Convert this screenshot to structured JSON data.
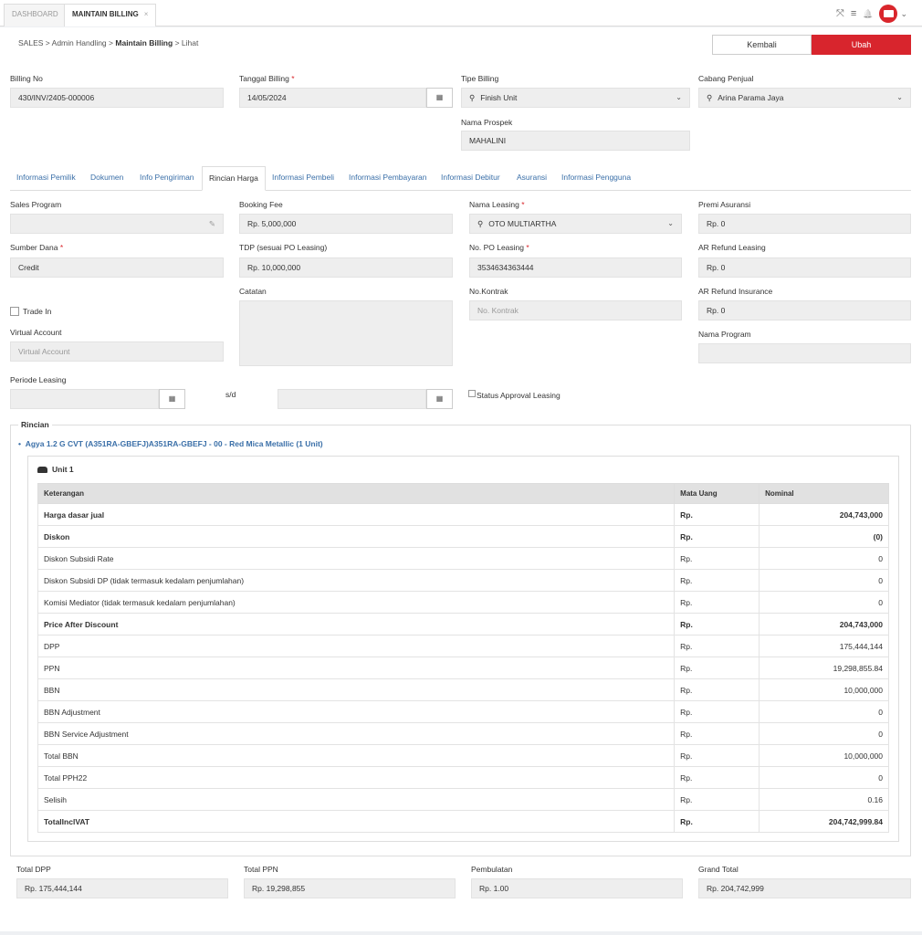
{
  "tabs": [
    {
      "label": "DASHBOARD"
    },
    {
      "label": "MAINTAIN BILLING",
      "close": "×"
    }
  ],
  "breadcrumb": {
    "l1": "SALES",
    "l2": "Admin Handling",
    "l3": "Maintain Billing",
    "l4": "Lihat",
    "sep": ">"
  },
  "buttons": {
    "kembali": "Kembali",
    "ubah": "Ubah"
  },
  "header": {
    "billing_no": {
      "label": "Billing No",
      "value": "430/INV/2405-000006"
    },
    "tanggal_billing": {
      "label": "Tanggal Billing",
      "value": "14/05/2024"
    },
    "tipe_billing": {
      "label": "Tipe Billing",
      "value": "Finish Unit"
    },
    "cabang_penjual": {
      "label": "Cabang Penjual",
      "value": "Arina Parama Jaya"
    },
    "nama_prospek": {
      "label": "Nama Prospek",
      "value": "MAHALINI"
    }
  },
  "sections": [
    {
      "label": "Informasi Pemilik"
    },
    {
      "label": "Dokumen"
    },
    {
      "label": "Info Pengiriman"
    },
    {
      "label": "Rincian Harga"
    },
    {
      "label": "Informasi Pembeli"
    },
    {
      "label": "Informasi Pembayaran"
    },
    {
      "label": "Informasi Debitur"
    },
    {
      "label": "Asuransi"
    },
    {
      "label": "Informasi Pengguna"
    }
  ],
  "rincian_harga": {
    "sales_program": {
      "label": "Sales Program",
      "value": ""
    },
    "booking_fee": {
      "label": "Booking Fee",
      "value": "Rp. 5,000,000"
    },
    "nama_leasing": {
      "label": "Nama Leasing",
      "value": "OTO MULTIARTHA"
    },
    "premi_asuransi": {
      "label": "Premi Asuransi",
      "value": "Rp. 0"
    },
    "sumber_dana": {
      "label": "Sumber Dana",
      "value": "Credit"
    },
    "tdp": {
      "label": "TDP (sesuai PO Leasing)",
      "value": "Rp. 10,000,000"
    },
    "no_po_leasing": {
      "label": "No. PO Leasing",
      "value": "3534634363444"
    },
    "ar_refund_leasing": {
      "label": "AR Refund Leasing",
      "value": "Rp. 0"
    },
    "catatan": {
      "label": "Catatan",
      "value": ""
    },
    "no_kontrak": {
      "label": "No.Kontrak",
      "placeholder": "No. Kontrak"
    },
    "ar_refund_insurance": {
      "label": "AR Refund Insurance",
      "value": "Rp. 0"
    },
    "trade_in": {
      "label": "Trade In"
    },
    "virtual_account": {
      "label": "Virtual Account",
      "placeholder": "Virtual Account"
    },
    "nama_program": {
      "label": "Nama Program",
      "value": ""
    },
    "periode_leasing": {
      "label": "Periode Leasing",
      "sd": "s/d"
    },
    "status_approval": {
      "label": "Status Approval Leasing"
    }
  },
  "rincian": {
    "legend": "Rincian",
    "unit_link": "Agya 1.2 G CVT (A351RA-GBEFJ)A351RA-GBEFJ - 00 - Red Mica Metallic  (1 Unit)",
    "unit_title": "Unit 1",
    "columns": {
      "keterangan": "Keterangan",
      "mata_uang": "Mata Uang",
      "nominal": "Nominal"
    },
    "rows": [
      {
        "ket": "Harga dasar jual",
        "mu": "Rp.",
        "nom": "204,743,000",
        "bold": true
      },
      {
        "ket": "Diskon",
        "mu": "Rp.",
        "nom": "(0)",
        "bold": true
      },
      {
        "ket": "Diskon Subsidi Rate",
        "mu": "Rp.",
        "nom": "0",
        "bold": false
      },
      {
        "ket": "Diskon Subsidi DP (tidak termasuk kedalam penjumlahan)",
        "mu": "Rp.",
        "nom": "0",
        "bold": false
      },
      {
        "ket": "Komisi Mediator (tidak termasuk kedalam penjumlahan)",
        "mu": "Rp.",
        "nom": "0",
        "bold": false
      },
      {
        "ket": "Price After Discount",
        "mu": "Rp.",
        "nom": "204,743,000",
        "bold": true
      },
      {
        "ket": "DPP",
        "mu": "Rp.",
        "nom": "175,444,144",
        "bold": false
      },
      {
        "ket": "PPN",
        "mu": "Rp.",
        "nom": "19,298,855.84",
        "bold": false
      },
      {
        "ket": "BBN",
        "mu": "Rp.",
        "nom": "10,000,000",
        "bold": false
      },
      {
        "ket": "BBN Adjustment",
        "mu": "Rp.",
        "nom": "0",
        "bold": false
      },
      {
        "ket": "BBN Service Adjustment",
        "mu": "Rp.",
        "nom": "0",
        "bold": false
      },
      {
        "ket": "Total BBN",
        "mu": "Rp.",
        "nom": "10,000,000",
        "bold": false
      },
      {
        "ket": "Total PPH22",
        "mu": "Rp.",
        "nom": "0",
        "bold": false
      },
      {
        "ket": "Selisih",
        "mu": "Rp.",
        "nom": "0.16",
        "bold": false
      },
      {
        "ket": "TotalInclVAT",
        "mu": "Rp.",
        "nom": "204,742,999.84",
        "bold": true
      }
    ]
  },
  "totals": {
    "total_dpp": {
      "label": "Total DPP",
      "value": "Rp. 175,444,144"
    },
    "total_ppn": {
      "label": "Total PPN",
      "value": "Rp. 19,298,855"
    },
    "pembulatan": {
      "label": "Pembulatan",
      "value": "Rp. 1.00"
    },
    "grand_total": {
      "label": "Grand Total",
      "value": "Rp. 204,742,999"
    }
  },
  "glyphs": {
    "required": "*",
    "chevron": "⌄",
    "search": "🔍",
    "pencil": "✎",
    "calendar": "▦",
    "expand": "⤧",
    "menu": "≡",
    "bell": "🔔",
    "user_chevron": "⌄"
  },
  "colors": {
    "accent": "#d8252d",
    "link": "#3a6fa8"
  }
}
